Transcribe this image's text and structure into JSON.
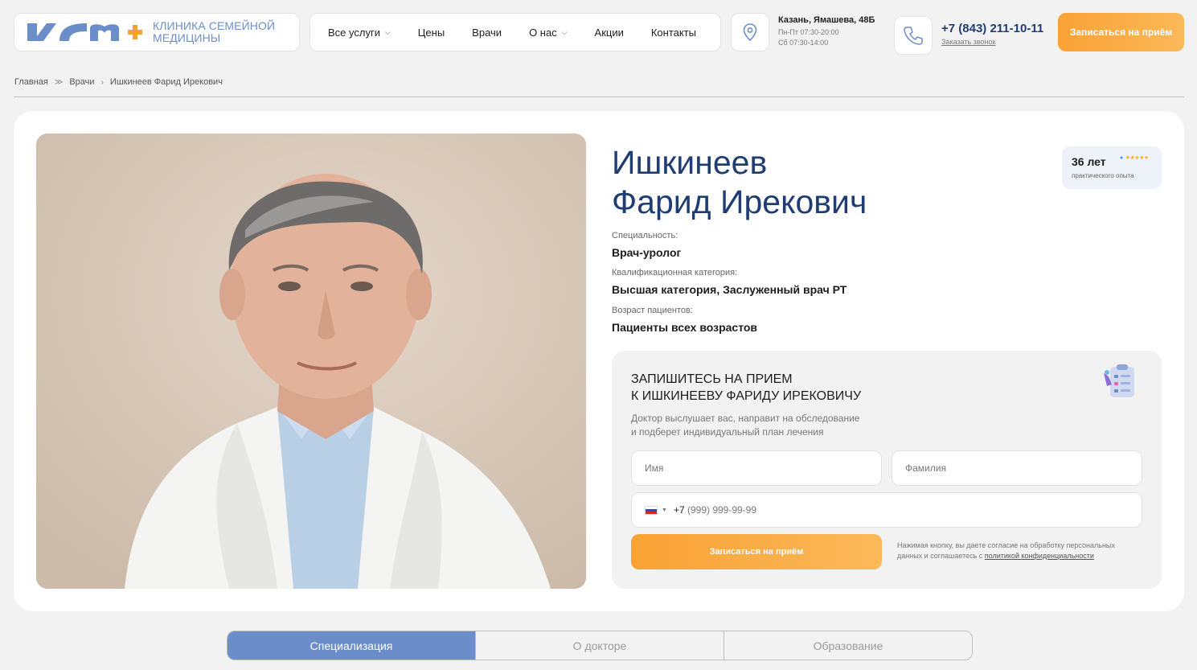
{
  "header": {
    "logo_text_line1": "Клиника семейной",
    "logo_text_line2": "медицины",
    "nav": [
      {
        "label": "Все услуги",
        "has_dropdown": true
      },
      {
        "label": "Цены",
        "has_dropdown": false
      },
      {
        "label": "Врачи",
        "has_dropdown": false
      },
      {
        "label": "О нас",
        "has_dropdown": true
      },
      {
        "label": "Акции",
        "has_dropdown": false
      },
      {
        "label": "Контакты",
        "has_dropdown": false
      }
    ],
    "address": "Казань, Ямашева, 48Б",
    "hours_weekdays": "Пн-Пт 07:30-20:00",
    "hours_saturday": "Сб 07:30-14:00",
    "phone": "+7 (843) 211-10-11",
    "callback_label": "Заказать звонок",
    "cta_label": "Записаться на приём"
  },
  "breadcrumbs": [
    "Главная",
    "Врачи",
    "Ишкинеев Фарид Ирекович"
  ],
  "doctor": {
    "name_line1": "Ишкинеев",
    "name_line2": "Фарид Ирекович",
    "experience_years": "36 лет",
    "experience_label": "практического опыта",
    "fields": [
      {
        "label": "Специальность:",
        "value": "Врач-уролог"
      },
      {
        "label": "Квалификационная категория:",
        "value": "Высшая категория, Заслуженный врач РТ"
      },
      {
        "label": "Возраст пациентов:",
        "value": "Пациенты всех возрастов"
      }
    ]
  },
  "form": {
    "title_line1": "Запишитесь на прием",
    "title_line2": "к Ишкинееву Фариду Ирековичу",
    "desc_line1": "Доктор выслушает вас, направит на обследование",
    "desc_line2": "и подберет индивидуальный план лечения",
    "first_name_placeholder": "Имя",
    "last_name_placeholder": "Фамилия",
    "phone_prefix": "+7",
    "phone_placeholder": "(999) 999-99-99",
    "submit_label": "Записаться на приём",
    "consent_text": "Нажимая кнопку, вы даете согласие на обработку персональных данных и соглашаетесь с ",
    "consent_link": "политикой конфиденциальности"
  },
  "tabs": [
    {
      "label": "Специализация",
      "active": true
    },
    {
      "label": "О докторе",
      "active": false
    },
    {
      "label": "Образование",
      "active": false
    }
  ],
  "colors": {
    "brand_blue": "#6b8ecb",
    "dark_blue": "#1f3d73",
    "accent_orange": "#f9a134"
  }
}
